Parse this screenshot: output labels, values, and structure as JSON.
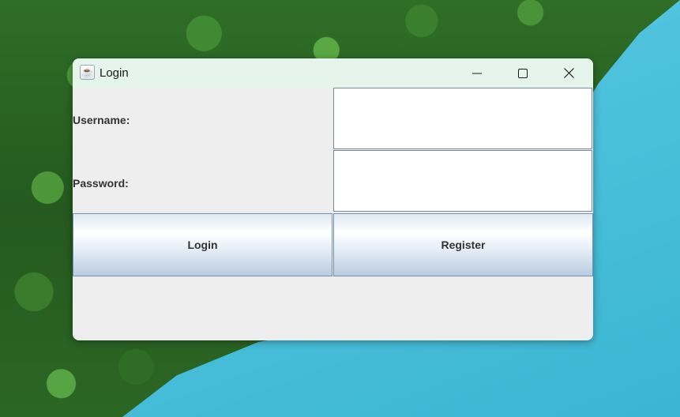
{
  "window": {
    "title": "Login",
    "app_icon": "java-icon",
    "controls": {
      "minimize": "minimize-icon",
      "maximize": "maximize-icon",
      "close": "close-icon"
    }
  },
  "form": {
    "username_label": "Username:",
    "username_value": "",
    "password_label": "Password:",
    "password_value": "",
    "login_button": "Login",
    "register_button": "Register"
  },
  "colors": {
    "titlebar": "#e6f5ec",
    "window_bg": "#eeeeee",
    "button_border": "#7a8fa8"
  }
}
